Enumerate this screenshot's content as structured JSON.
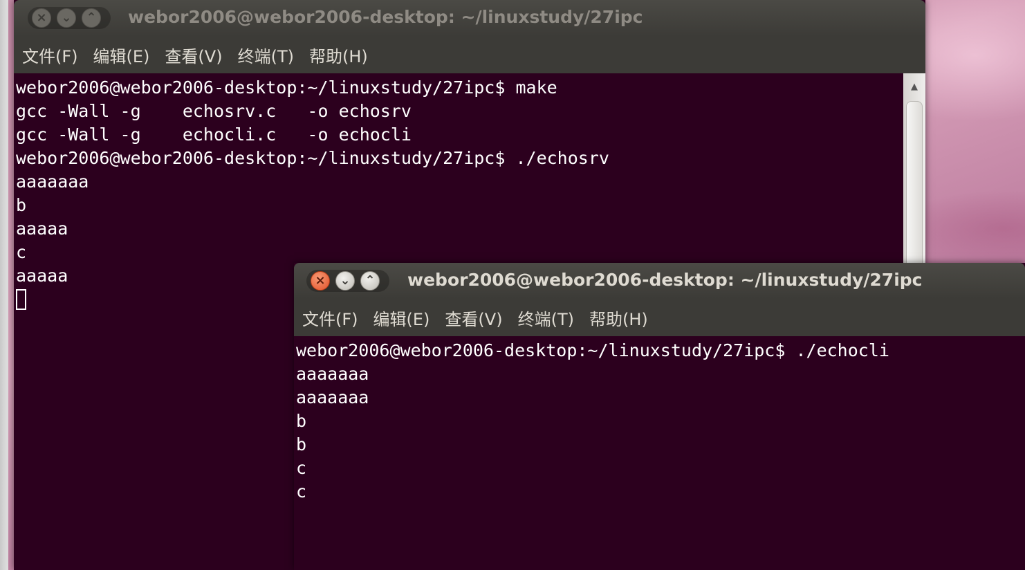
{
  "colors": {
    "terminal_bg": "#2c001e",
    "titlebar_bg": "#3c3b37",
    "active_title_text": "#dfdbd2",
    "inactive_title_text": "#8f8b84",
    "terminal_text": "#ffffff",
    "close_button_active": "#f0744a"
  },
  "back_window": {
    "title": "webor2006@webor2006-desktop: ~/linuxstudy/27ipc",
    "buttons": {
      "close_icon": "close-icon",
      "minimize_icon": "minimize-icon",
      "maximize_icon": "maximize-icon"
    },
    "menu": [
      "文件(F)",
      "编辑(E)",
      "查看(V)",
      "终端(T)",
      "帮助(H)"
    ],
    "lines": [
      "webor2006@webor2006-desktop:~/linuxstudy/27ipc$ make",
      "gcc -Wall -g    echosrv.c   -o echosrv",
      "gcc -Wall -g    echocli.c   -o echocli",
      "webor2006@webor2006-desktop:~/linuxstudy/27ipc$ ./echosrv",
      "aaaaaaa",
      "b",
      "aaaaa",
      "c",
      "aaaaa"
    ]
  },
  "front_window": {
    "title": "webor2006@webor2006-desktop: ~/linuxstudy/27ipc",
    "buttons": {
      "close_icon": "close-icon",
      "minimize_icon": "minimize-icon",
      "maximize_icon": "maximize-icon"
    },
    "menu": [
      "文件(F)",
      "编辑(E)",
      "查看(V)",
      "终端(T)",
      "帮助(H)"
    ],
    "lines": [
      "webor2006@webor2006-desktop:~/linuxstudy/27ipc$ ./echocli",
      "aaaaaaa",
      "aaaaaaa",
      "b",
      "b",
      "c",
      "c"
    ]
  }
}
